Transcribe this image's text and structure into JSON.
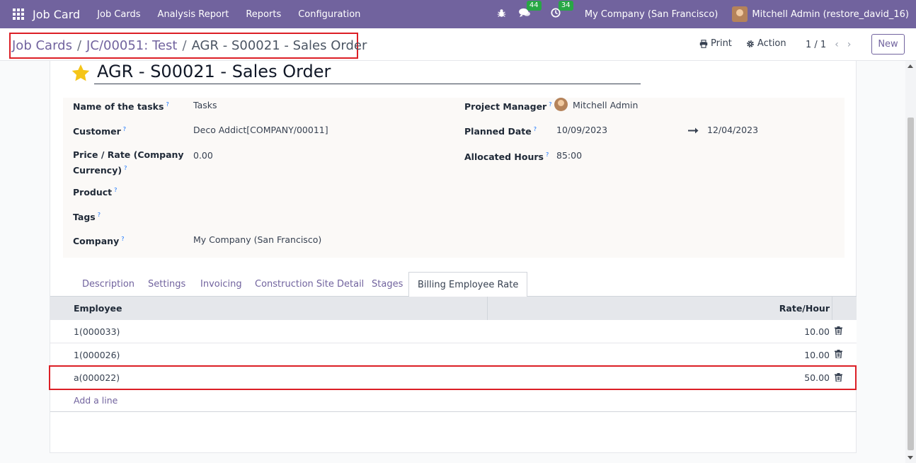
{
  "navbar": {
    "brand": "Job Card",
    "menu": [
      "Job Cards",
      "Analysis Report",
      "Reports",
      "Configuration"
    ],
    "messages_count": "44",
    "activities_count": "34",
    "company": "My Company (San Francisco)",
    "user": "Mitchell Admin (restore_david_16)"
  },
  "breadcrumb": {
    "items": [
      "Job Cards",
      "JC/00051: Test"
    ],
    "active": "AGR - S00021 - Sales Order",
    "sep": "/"
  },
  "control": {
    "print_label": "Print",
    "action_label": "Action",
    "pager": "1 / 1",
    "new_label": "New"
  },
  "record": {
    "title": "AGR - S00021 - Sales Order"
  },
  "fields_left": [
    {
      "label": "Name of the tasks",
      "value": "Tasks"
    },
    {
      "label": "Customer",
      "value": "Deco Addict[COMPANY/00011]"
    },
    {
      "label": "Price / Rate (Company",
      "label2": "Currency)",
      "value": "0.00"
    },
    {
      "label": "Product",
      "value": ""
    },
    {
      "label": "Tags",
      "value": ""
    },
    {
      "label": "Company",
      "value": "My Company (San Francisco)"
    }
  ],
  "fields_right": {
    "project_manager_label": "Project Manager",
    "project_manager": "Mitchell Admin",
    "planned_date_label": "Planned Date",
    "planned_start": "10/09/2023",
    "planned_end": "12/04/2023",
    "allocated_hours_label": "Allocated Hours",
    "allocated_hours": "85:00"
  },
  "tooltip_mark": "?",
  "tabs": [
    "Description",
    "Settings",
    "Invoicing",
    "Construction Site Detail",
    "Stages",
    "Billing Employee Rate"
  ],
  "table": {
    "headers": {
      "employee": "Employee",
      "rate": "Rate/Hour"
    },
    "rows": [
      {
        "employee": "1(000033)",
        "rate": "10.00"
      },
      {
        "employee": "1(000026)",
        "rate": "10.00"
      },
      {
        "employee": "a(000022)",
        "rate": "50.00"
      }
    ],
    "add_line": "Add a line"
  },
  "colors": {
    "navbar": "#71639e",
    "highlight": "#dc1f26",
    "link": "#71639e",
    "star": "#f5c518"
  },
  "icons": [
    "apps-grid-icon",
    "bug-icon",
    "chat-icon",
    "clock-icon",
    "print-icon",
    "gear-icon",
    "star-icon",
    "trash-icon",
    "arrow-right-icon",
    "chevron-left-icon",
    "chevron-right-icon"
  ]
}
